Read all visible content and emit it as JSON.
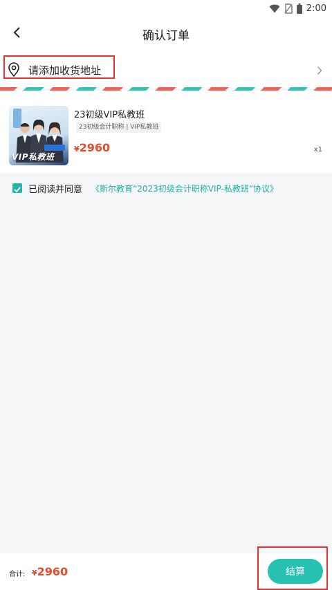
{
  "status_bar": {
    "time": "2:00",
    "icons": [
      "wifi-icon",
      "no-sim-icon",
      "battery-icon"
    ]
  },
  "header": {
    "title": "确认订单",
    "back_icon": "back-arrow-icon"
  },
  "address": {
    "label": "请添加收货地址",
    "icon": "location-pin-icon",
    "chevron": "chevron-right-icon"
  },
  "product": {
    "name": "23初级VIP私教班",
    "tags": "23初级会计职称 | VIP私教班",
    "currency": "¥",
    "price": "2960",
    "quantity": "x1",
    "thumbnail_text": "VIP私教班"
  },
  "agreement": {
    "checked": true,
    "text": "已阅读并同意",
    "link": "《斯尔教育“2023初级会计职称VIP-私教班”协议》"
  },
  "footer": {
    "total_label": "合计:",
    "currency": "¥",
    "total_price": "2960",
    "checkout_label": "结算"
  },
  "colors": {
    "accent": "#26c1b0",
    "price": "#e84a2e",
    "highlight": "#e5322d",
    "stripe_red": "#f0615a",
    "stripe_teal": "#35c3b6"
  }
}
